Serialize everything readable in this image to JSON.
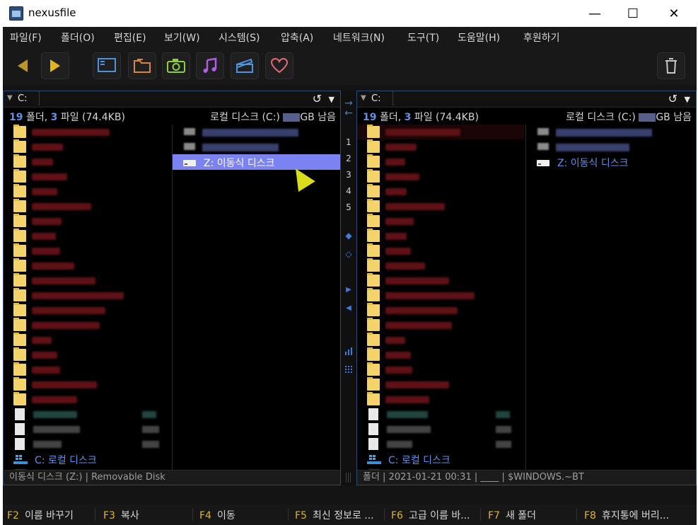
{
  "window": {
    "title": "nexusfile",
    "minimize_glyph": "—",
    "maximize_glyph": "☐",
    "close_glyph": "✕"
  },
  "menu": [
    "파일(F)",
    "폴더(O)",
    "편집(E)",
    "보기(W)",
    "시스템(S)",
    "압축(A)",
    "네트워크(N)",
    "도구(T)",
    "도움말(H)",
    "후원하기"
  ],
  "toolbar": {
    "icons": [
      "back-arrow-icon",
      "forward-arrow-icon",
      "monitor-icon",
      "folder-icon",
      "camera-icon",
      "music-note-icon",
      "film-icon",
      "heart-icon",
      "trash-icon"
    ],
    "colors": {
      "back": "#b99628",
      "forward": "#e2b51d",
      "monitor": "#4d93e0",
      "folder": "#d6883a",
      "camera": "#8bd13d",
      "music": "#b25be8",
      "film": "#4d93e0",
      "heart": "#e8697b",
      "trash": "#c8c8c8"
    }
  },
  "left_panel": {
    "path_drive": "C:",
    "refresh_glyph": "↺",
    "dropdown_glyph": "▼",
    "summary": {
      "folders": "19",
      "folders_label": "폴더,",
      "files": "3",
      "files_label": "파일",
      "size": "(74.4KB)"
    },
    "disk_info": {
      "prefix": "로컬 디스크 (C:)",
      "suffix": "GB 남음"
    },
    "list_drive_name": "C: 로컬 디스크",
    "selected_drive_name": "Z: 이동식 디스크",
    "status": "이동식 디스크 (Z:)  |  Removable Disk"
  },
  "right_panel": {
    "path_drive": "C:",
    "refresh_glyph": "↺",
    "dropdown_glyph": "▼",
    "summary": {
      "folders": "19",
      "folders_label": "폴더,",
      "files": "3",
      "files_label": "파일",
      "size": "(74.4KB)"
    },
    "disk_info": {
      "prefix": "로컬 디스크 (C:)",
      "suffix": "GB 남음"
    },
    "list_drive_name": "C: 로컬 디스크",
    "side_drive_name": "Z: 이동식 디스크",
    "status": "폴더  |  2021-01-21 00:31  |  ____  |  $WINDOWS.~BT"
  },
  "middle_strip": {
    "top_arrows": [
      "→",
      "←"
    ],
    "numbers": [
      "1",
      "2",
      "3",
      "4",
      "5"
    ],
    "arrows": [
      "▶",
      "◀"
    ]
  },
  "fkeys": [
    {
      "key": "F2",
      "label": "이름 바꾸기"
    },
    {
      "key": "F3",
      "label": "복사"
    },
    {
      "key": "F4",
      "label": "이동"
    },
    {
      "key": "F5",
      "label": "최신 정보로 ..."
    },
    {
      "key": "F6",
      "label": "고급 이름 바..."
    },
    {
      "key": "F7",
      "label": "새 폴더"
    },
    {
      "key": "F8",
      "label": "휴지통에 버리..."
    }
  ]
}
